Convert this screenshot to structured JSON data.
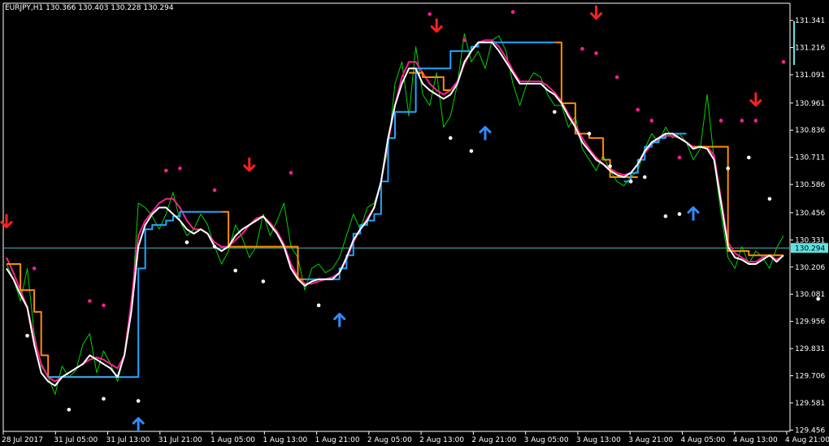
{
  "chart_data": {
    "type": "line",
    "title": "EURJPY,H1  130.366 130.403 130.228 130.294",
    "current_price": 130.294,
    "current_price_label": "130.294",
    "y_range": [
      129.45,
      131.42
    ],
    "y_ticks": [
      "131.341",
      "131.216",
      "131.091",
      "130.961",
      "130.836",
      "130.711",
      "130.586",
      "130.456",
      "130.331",
      "130.206",
      "130.081",
      "129.956",
      "129.831",
      "129.706",
      "129.581",
      "129.456"
    ],
    "x_ticks": [
      "28 Jul 2017",
      "31 Jul 05:00",
      "31 Jul 13:00",
      "31 Jul 21:00",
      "1 Aug 05:00",
      "1 Aug 13:00",
      "1 Aug 21:00",
      "2 Aug 05:00",
      "2 Aug 13:00",
      "2 Aug 21:00",
      "3 Aug 05:00",
      "3 Aug 13:00",
      "3 Aug 21:00",
      "4 Aug 05:00",
      "4 Aug 13:00",
      "4 Aug 21:00"
    ],
    "colors": {
      "background": "#000000",
      "axis": "#ffffff",
      "price": "#00d400",
      "fast": "#ffffff",
      "mid": "#ff1f8f",
      "step_up": "#1ea7ff",
      "step_down": "#ff8c00",
      "signal_down": "#ff2020",
      "signal_up": "#2f8bff",
      "dot_upper": "#ff1f8f",
      "dot_lower": "#ffffff",
      "price_line": "#4fbcbc",
      "price_label_bg": "#5fe3e3"
    },
    "series": [
      {
        "key": "price",
        "values": [
          130.22,
          130.15,
          130.05,
          130.2,
          129.9,
          129.75,
          129.7,
          129.62,
          129.75,
          129.7,
          129.73,
          129.85,
          129.9,
          129.72,
          129.82,
          129.76,
          129.68,
          129.8,
          130.0,
          130.5,
          130.48,
          130.44,
          130.38,
          130.45,
          130.55,
          130.42,
          130.35,
          130.38,
          130.45,
          130.4,
          130.3,
          130.22,
          130.28,
          130.4,
          130.34,
          130.25,
          130.3,
          130.45,
          130.35,
          130.42,
          130.5,
          130.3,
          130.25,
          130.1,
          130.2,
          130.22,
          130.18,
          130.2,
          130.25,
          130.35,
          130.45,
          130.38,
          130.48,
          130.5,
          130.6,
          130.75,
          131.05,
          131.15,
          130.9,
          131.22,
          131.0,
          130.95,
          131.1,
          130.85,
          130.9,
          131.05,
          131.28,
          131.15,
          131.2,
          131.12,
          131.25,
          131.27,
          131.2,
          131.05,
          130.95,
          131.05,
          131.1,
          131.08,
          131.0,
          130.95,
          130.95,
          130.85,
          130.9,
          130.75,
          130.7,
          130.65,
          130.72,
          130.65,
          130.6,
          130.58,
          130.62,
          130.65,
          130.75,
          130.82,
          130.78,
          130.85,
          130.8,
          130.82,
          130.78,
          130.7,
          130.75,
          131.0,
          130.7,
          130.45,
          130.25,
          130.2,
          130.3,
          130.22,
          130.28,
          130.25,
          130.2,
          130.294,
          130.35
        ]
      },
      {
        "key": "fast",
        "values": [
          130.2,
          130.15,
          130.08,
          130.02,
          129.85,
          129.72,
          129.68,
          129.66,
          129.7,
          129.72,
          129.74,
          129.76,
          129.8,
          129.78,
          129.76,
          129.74,
          129.7,
          129.8,
          130.0,
          130.3,
          130.4,
          130.45,
          130.48,
          130.48,
          130.45,
          130.42,
          130.38,
          130.36,
          130.38,
          130.36,
          130.3,
          130.28,
          130.3,
          130.35,
          130.38,
          130.4,
          130.42,
          130.44,
          130.4,
          130.36,
          130.3,
          130.2,
          130.15,
          130.12,
          130.14,
          130.15,
          130.15,
          130.15,
          130.18,
          130.25,
          130.33,
          130.38,
          130.42,
          130.48,
          130.6,
          130.8,
          130.95,
          131.05,
          131.12,
          131.12,
          131.05,
          131.02,
          131.0,
          130.98,
          131.0,
          131.05,
          131.15,
          131.2,
          131.24,
          131.24,
          131.24,
          131.2,
          131.15,
          131.1,
          131.05,
          131.05,
          131.05,
          131.05,
          131.02,
          131.0,
          130.96,
          130.9,
          130.85,
          130.78,
          130.74,
          130.7,
          130.68,
          130.65,
          130.63,
          130.62,
          130.64,
          130.68,
          130.74,
          130.78,
          130.8,
          130.82,
          130.82,
          130.8,
          130.78,
          130.75,
          130.76,
          130.75,
          130.7,
          130.5,
          130.3,
          130.25,
          130.24,
          130.22,
          130.22,
          130.24,
          130.26,
          130.23,
          130.26
        ]
      },
      {
        "key": "mid",
        "values": [
          130.25,
          130.18,
          130.1,
          130.02,
          129.88,
          129.76,
          129.7,
          129.68,
          129.7,
          129.72,
          129.74,
          129.76,
          129.78,
          129.79,
          129.78,
          129.76,
          129.74,
          129.8,
          130.05,
          130.35,
          130.42,
          130.46,
          130.5,
          130.52,
          130.52,
          130.48,
          130.42,
          130.38,
          130.38,
          130.36,
          130.32,
          130.3,
          130.3,
          130.33,
          130.36,
          130.4,
          130.43,
          130.44,
          130.41,
          130.37,
          130.31,
          130.22,
          130.16,
          130.13,
          130.13,
          130.14,
          130.15,
          130.16,
          130.18,
          130.24,
          130.32,
          130.38,
          130.43,
          130.48,
          130.6,
          130.78,
          130.95,
          131.08,
          131.15,
          131.15,
          131.1,
          131.05,
          131.02,
          131.0,
          131.02,
          131.06,
          131.14,
          131.2,
          131.24,
          131.25,
          131.25,
          131.22,
          131.17,
          131.11,
          131.06,
          131.06,
          131.06,
          131.06,
          131.04,
          131.01,
          130.97,
          130.91,
          130.86,
          130.8,
          130.75,
          130.71,
          130.68,
          130.66,
          130.64,
          130.63,
          130.64,
          130.68,
          130.73,
          130.77,
          130.8,
          130.81,
          130.81,
          130.8,
          130.78,
          130.76,
          130.76,
          130.76,
          130.72,
          130.52,
          130.32,
          130.27,
          130.25,
          130.23,
          130.23,
          130.25,
          130.26,
          130.24,
          130.26
        ]
      },
      {
        "key": "step_up",
        "values": [
          null,
          null,
          null,
          null,
          null,
          null,
          129.7,
          129.7,
          129.7,
          129.7,
          129.7,
          129.7,
          129.7,
          129.7,
          129.7,
          129.7,
          129.7,
          129.7,
          129.7,
          130.2,
          130.38,
          130.4,
          130.4,
          130.42,
          130.44,
          130.46,
          130.46,
          130.46,
          130.46,
          130.46,
          130.46,
          130.46,
          null,
          null,
          null,
          null,
          null,
          null,
          null,
          null,
          null,
          null,
          null,
          130.15,
          130.15,
          130.15,
          130.15,
          130.15,
          130.2,
          130.26,
          130.36,
          130.4,
          130.42,
          130.45,
          130.6,
          130.8,
          130.92,
          130.92,
          130.92,
          131.12,
          131.12,
          131.12,
          131.12,
          131.12,
          131.2,
          131.2,
          131.2,
          131.22,
          131.24,
          131.24,
          131.24,
          131.24,
          131.24,
          131.24,
          131.24,
          131.24,
          131.24,
          131.24,
          131.24,
          131.24,
          null,
          null,
          null,
          null,
          null,
          null,
          null,
          null,
          null,
          130.6,
          130.64,
          130.7,
          130.76,
          130.78,
          130.8,
          130.82,
          130.82,
          130.82,
          130.82,
          null,
          null,
          null,
          null,
          null,
          null,
          null,
          null,
          null,
          null,
          null,
          null,
          null,
          null
        ]
      },
      {
        "key": "step_down",
        "values": [
          130.22,
          130.22,
          130.1,
          130.1,
          130.0,
          129.8,
          129.7,
          129.7,
          129.7,
          129.7,
          129.7,
          129.7,
          129.7,
          129.7,
          129.7,
          129.7,
          129.7,
          null,
          null,
          null,
          null,
          null,
          null,
          null,
          null,
          null,
          null,
          null,
          null,
          null,
          null,
          130.46,
          130.3,
          130.3,
          130.3,
          130.3,
          130.3,
          130.3,
          130.3,
          130.3,
          130.3,
          130.3,
          130.15,
          130.15,
          null,
          null,
          null,
          null,
          null,
          null,
          null,
          null,
          null,
          null,
          null,
          null,
          null,
          null,
          131.1,
          131.1,
          131.08,
          131.08,
          131.08,
          131.02,
          131.02,
          null,
          null,
          null,
          null,
          null,
          null,
          null,
          null,
          null,
          null,
          null,
          null,
          null,
          null,
          131.24,
          130.96,
          130.96,
          130.82,
          130.82,
          130.8,
          130.8,
          130.7,
          130.62,
          130.62,
          130.62,
          130.62,
          130.62,
          null,
          null,
          null,
          null,
          null,
          null,
          null,
          130.76,
          130.76,
          130.76,
          130.76,
          130.76,
          130.28,
          130.28,
          130.28,
          130.26,
          130.26,
          130.26,
          130.26,
          130.26,
          130.26
        ]
      }
    ],
    "signals_down": [
      {
        "x": 0,
        "y": 130.42
      },
      {
        "x": 35,
        "y": 130.68
      },
      {
        "x": 62,
        "y": 131.32
      },
      {
        "x": 85,
        "y": 131.38
      },
      {
        "x": 108,
        "y": 130.98
      }
    ],
    "signals_up": [
      {
        "x": 19,
        "y": 129.48
      },
      {
        "x": 48,
        "y": 129.96
      },
      {
        "x": 69,
        "y": 130.82
      },
      {
        "x": 99,
        "y": 130.45
      }
    ],
    "dots_upper": [
      [
        4,
        130.2
      ],
      [
        12,
        130.05
      ],
      [
        14,
        130.03
      ],
      [
        23,
        130.65
      ],
      [
        25,
        130.66
      ],
      [
        30,
        130.56
      ],
      [
        41,
        130.64
      ],
      [
        61,
        131.37
      ],
      [
        66,
        131.25
      ],
      [
        73,
        131.38
      ],
      [
        83,
        131.21
      ],
      [
        85,
        131.19
      ],
      [
        88,
        131.08
      ],
      [
        91,
        130.93
      ],
      [
        93,
        130.88
      ],
      [
        97,
        130.71
      ],
      [
        103,
        130.88
      ],
      [
        106,
        130.88
      ],
      [
        108,
        130.88
      ],
      [
        112,
        131.15
      ]
    ],
    "dots_lower": [
      [
        3,
        129.89
      ],
      [
        9,
        129.55
      ],
      [
        14,
        129.6
      ],
      [
        19,
        129.59
      ],
      [
        26,
        130.32
      ],
      [
        30,
        130.3
      ],
      [
        33,
        130.19
      ],
      [
        37,
        130.14
      ],
      [
        45,
        130.03
      ],
      [
        64,
        130.8
      ],
      [
        67,
        130.74
      ],
      [
        79,
        130.92
      ],
      [
        84,
        130.82
      ],
      [
        87,
        130.67
      ],
      [
        90,
        130.6
      ],
      [
        92,
        130.62
      ],
      [
        95,
        130.44
      ],
      [
        97,
        130.45
      ],
      [
        104,
        130.66
      ],
      [
        107,
        130.71
      ],
      [
        110,
        130.52
      ],
      [
        117,
        130.06
      ]
    ]
  }
}
